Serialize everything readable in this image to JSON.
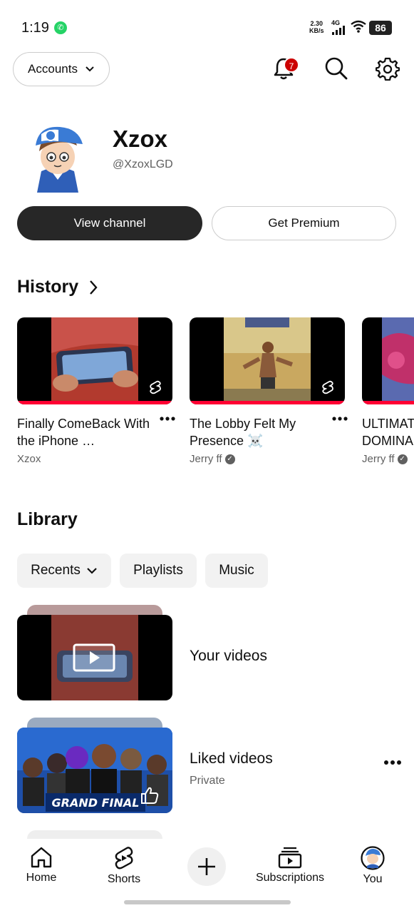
{
  "status_bar": {
    "time": "1:19",
    "net_rate_value": "2.30",
    "net_rate_unit": "KB/s",
    "network": "4G",
    "battery": "86"
  },
  "top_bar": {
    "accounts_label": "Accounts",
    "notifications_count": "7"
  },
  "profile": {
    "name": "Xzox",
    "handle": "@XzoxLGD",
    "view_channel_label": "View channel",
    "premium_label": "Get Premium"
  },
  "history": {
    "title": "History",
    "items": [
      {
        "title": "Finally ComeBack With the iPhone …",
        "channel": "Xzox",
        "verified": false
      },
      {
        "title": "The Lobby Felt My Presence ☠️",
        "channel": "Jerry ff",
        "verified": true
      },
      {
        "title": "ULTIMATE DOMINA",
        "channel": "Jerry ff",
        "verified": true
      }
    ]
  },
  "library": {
    "title": "Library",
    "chips": [
      "Recents",
      "Playlists",
      "Music"
    ],
    "rows": [
      {
        "title": "Your videos",
        "subtitle": ""
      },
      {
        "title": "Liked videos",
        "subtitle": "Private"
      }
    ],
    "liked_thumb_text": "GRAND FINAL"
  },
  "bottom_nav": {
    "home": "Home",
    "shorts": "Shorts",
    "subscriptions": "Subscriptions",
    "you": "You"
  },
  "colors": {
    "accent_red": "#ff0033",
    "badge_red": "#cc0000",
    "dark_button": "#272727",
    "chip_bg": "#f2f2f2"
  }
}
